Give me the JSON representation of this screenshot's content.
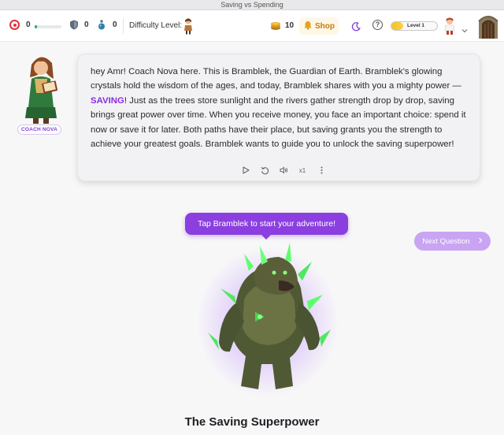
{
  "window": {
    "title": "Saving vs Spending"
  },
  "topbar": {
    "goal_count": "0",
    "goal_progress": 0.08,
    "shield_count": "0",
    "potion_count": "0",
    "difficulty_label": "Difficulty Level:",
    "coins": "10",
    "shop_label": "Shop",
    "help_symbol": "?",
    "level_label": "Level 1",
    "level_progress": 0.25
  },
  "coach": {
    "badge": "COACH NOVA",
    "message_part1": "hey Amr! Coach Nova here. This is Bramblek, the Guardian of Earth. Bramblek's glowing crystals hold the wisdom of the ages, and today, Bramblek shares with you a mighty power — ",
    "message_highlight": "SAVING",
    "message_part2": "! Just as the trees store sunlight and the rivers gather strength drop by drop, saving brings great power over time. When you receive money, you face an important choice: spend it now or save it for later. Both paths have their place, but saving grants you the strength to achieve your greatest goals. Bramblek wants to guide you to unlock the saving superpower!",
    "speed": "x1"
  },
  "tooltip": "Tap Bramblek to start your adventure!",
  "next_button": "Next Question",
  "section_title": "The Saving Superpower",
  "colors": {
    "accent": "#8c3fe0",
    "highlight": "#8a2be2",
    "progress": "#19b07a",
    "level": "#f4c024"
  }
}
